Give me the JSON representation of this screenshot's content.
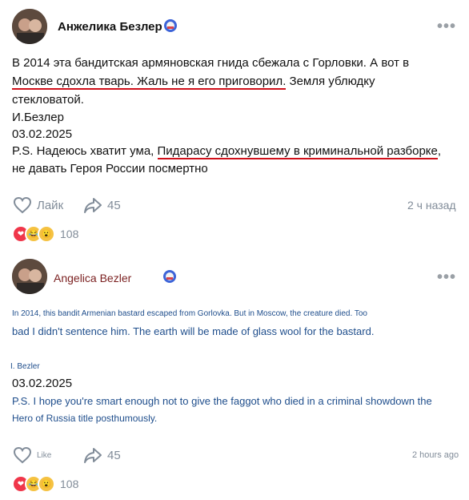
{
  "post1": {
    "author": "Анжелика Безлер",
    "line1": "В 2014 эта бандитская армяновская гнида сбежала с Горловки. А вот в",
    "line2_ul": "Москве сдохла тварь. Жаль не я его приговорил.",
    "line2_rest": " Земля ублюдку",
    "line3": "стекловатой.",
    "line4": "И.Безлер",
    "line5": "03.02.2025",
    "line6_pre": "P.S. Надеюсь хватит ума, ",
    "line6_ul": "Пидарасу сдохнувшему в криминальной разборке",
    "line6_post": ",",
    "line7": "не давать Героя России посмертно",
    "like_label": "Лайк",
    "shares": "45",
    "time": "2 ч назад",
    "reactions_count": "108"
  },
  "post2": {
    "author": "Angelica Bezler",
    "line1": "In 2014, this bandit Armenian bastard escaped from Gorlovka. But in Moscow, the creature died. Too",
    "line2": "bad I didn't sentence him. The earth will be made of glass wool for the bastard.",
    "line3": "I. Bezler",
    "line4": "03.02.2025",
    "line5": "P.S. I hope you're smart enough not to give the faggot who died in a criminal showdown the",
    "line6": "Hero of Russia title posthumously.",
    "like_label": "Like",
    "shares": "45",
    "time": "2 hours ago",
    "reactions_count": "108"
  },
  "colors": {
    "underline": "#d0101a",
    "meta": "#818c99",
    "translation": "#1f4e8c"
  },
  "icons": [
    "avatar",
    "verified-badge-icon",
    "more-dots-icon",
    "heart-icon",
    "share-arrow-icon",
    "reaction-heart-icon",
    "reaction-laugh-icon",
    "reaction-wow-icon"
  ]
}
